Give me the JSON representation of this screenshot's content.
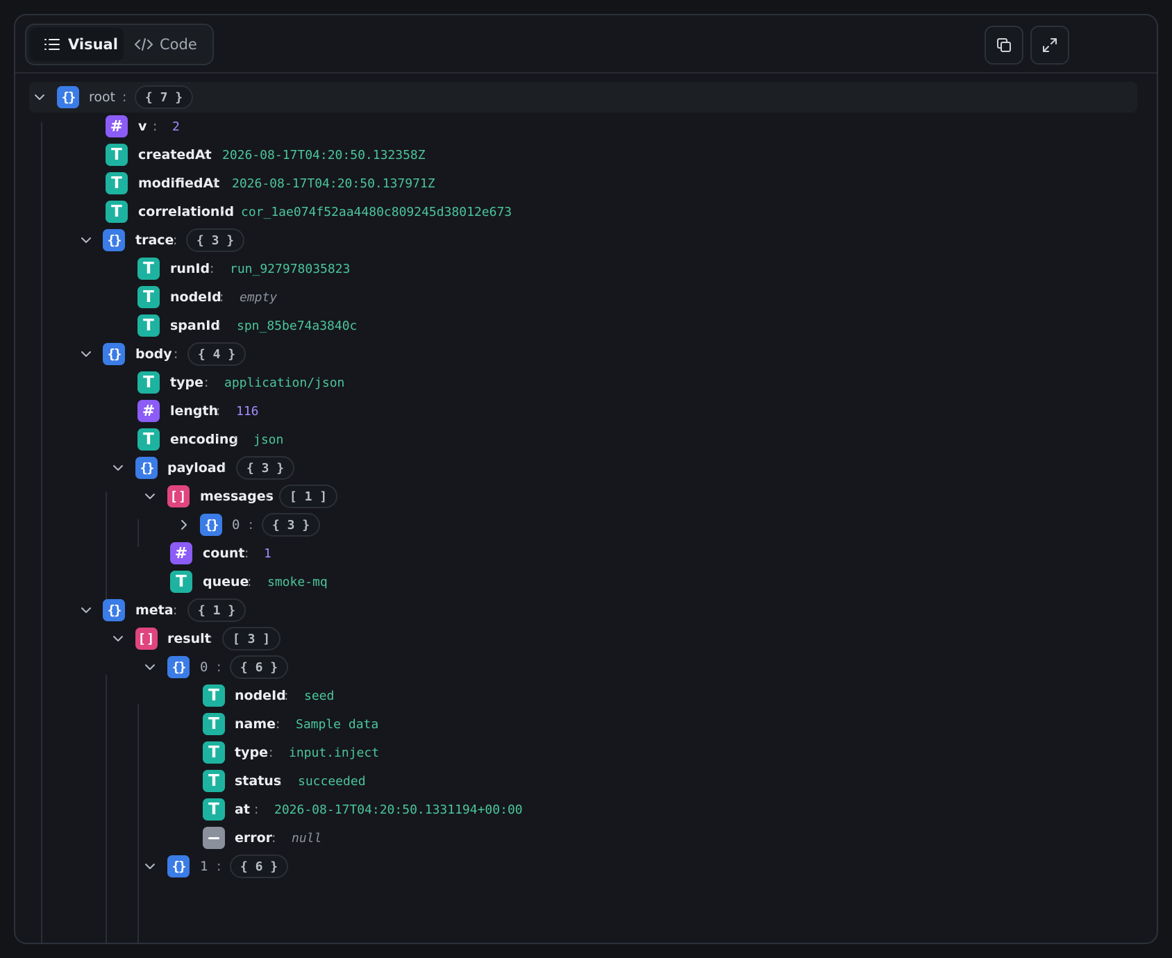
{
  "toolbar": {
    "tabs": [
      {
        "label": "Visual",
        "icon": "list-icon",
        "active": true
      },
      {
        "label": "Code",
        "icon": "code-icon",
        "active": false
      }
    ],
    "actions": [
      {
        "name": "copy",
        "icon": "copy-icon"
      },
      {
        "name": "expand",
        "icon": "expand-icon"
      }
    ]
  },
  "colors": {
    "object": "#3b7ce6",
    "array": "#e0457e",
    "number": "#8b5cf6",
    "string": "#1eb3a0",
    "null": "#8a909c",
    "string_value": "#4cc59a",
    "number_value": "#a68cff"
  },
  "tree": {
    "root": {
      "key": "root",
      "summary": "{ 7 }"
    },
    "v": {
      "key": "v",
      "value": "2"
    },
    "createdAt": {
      "key": "createdAt",
      "value": "2026-08-17T04:20:50.132358Z"
    },
    "modifiedAt": {
      "key": "modifiedAt",
      "value": "2026-08-17T04:20:50.137971Z"
    },
    "correlationId": {
      "key": "correlationId",
      "value": "cor_1ae074f52aa4480c809245d38012e673"
    },
    "trace": {
      "key": "trace",
      "summary": "{ 3 }",
      "runId": {
        "key": "runId",
        "value": "run_927978035823"
      },
      "nodeId": {
        "key": "nodeId",
        "value": "empty"
      },
      "spanId": {
        "key": "spanId",
        "value": "spn_85be74a3840c"
      }
    },
    "body": {
      "key": "body",
      "summary": "{ 4 }",
      "type": {
        "key": "type",
        "value": "application/json"
      },
      "length": {
        "key": "length",
        "value": "116"
      },
      "encoding": {
        "key": "encoding",
        "value": "json"
      },
      "payload": {
        "key": "payload",
        "summary": "{ 3 }",
        "messages": {
          "key": "messages",
          "summary": "[ 1 ]",
          "item0": {
            "key": "0",
            "summary": "{ 3 }"
          }
        },
        "count": {
          "key": "count",
          "value": "1"
        },
        "queue": {
          "key": "queue",
          "value": "smoke-mq"
        }
      }
    },
    "meta": {
      "key": "meta",
      "summary": "{ 1 }",
      "result": {
        "key": "result",
        "summary": "[ 3 ]",
        "item0": {
          "key": "0",
          "summary": "{ 6 }",
          "nodeId": {
            "key": "nodeId",
            "value": "seed"
          },
          "name": {
            "key": "name",
            "value": "Sample data"
          },
          "type": {
            "key": "type",
            "value": "input.inject"
          },
          "status": {
            "key": "status",
            "value": "succeeded"
          },
          "at": {
            "key": "at",
            "value": "2026-08-17T04:20:50.1331194+00:00"
          },
          "error": {
            "key": "error",
            "value": "null"
          }
        },
        "item1": {
          "key": "1",
          "summary": "{ 6 }"
        }
      }
    }
  }
}
